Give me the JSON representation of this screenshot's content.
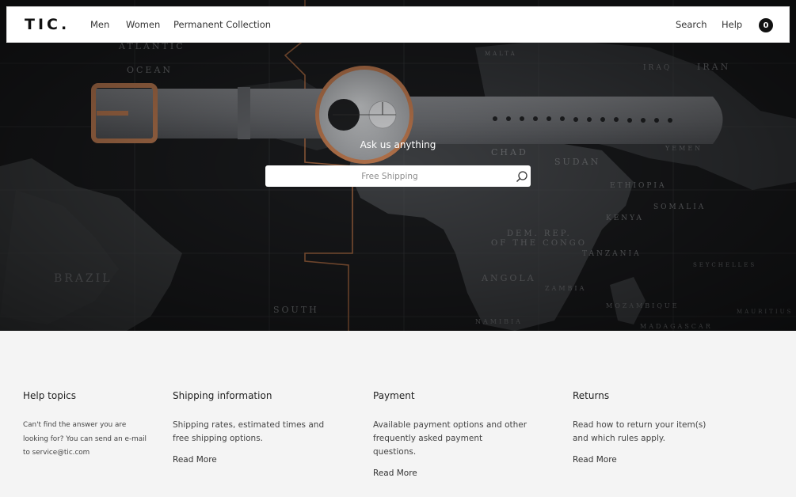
{
  "brand": {
    "logo": "TIC."
  },
  "nav": {
    "links": [
      "Men",
      "Women",
      "Permanent Collection"
    ],
    "search_label": "Search",
    "help_label": "Help",
    "cart_count": "0"
  },
  "hero": {
    "prompt": "Ask us anything",
    "search_placeholder": "Free Shipping"
  },
  "footer": {
    "help_topics": {
      "title": "Help topics",
      "text": "Can't find the answer you are looking for? You can send an e-mail to service@tic.com"
    },
    "shipping": {
      "title": "Shipping information",
      "text": "Shipping rates, estimated times and free shipping options.",
      "link": "Read More"
    },
    "payment": {
      "title": "Payment",
      "text": "Available payment options and other frequently asked payment questions.",
      "link": "Read More"
    },
    "returns": {
      "title": "Returns",
      "text": "Read how to return your item(s) and which rules apply.",
      "link": "Read More"
    }
  },
  "map_labels": [
    "ATLANTIC",
    "OCEAN",
    "BRAZIL",
    "SOUTH",
    "CHAD",
    "SUDAN",
    "ETHIOPIA",
    "SOMALIA",
    "KENYA",
    "TANZANIA",
    "ANGOLA",
    "ZAMBIA",
    "NAMIBIA",
    "MOZAMBIQUE",
    "IRAN",
    "IRAQ",
    "YEMEN",
    "DEM. REP. OF THE CONGO",
    "SEYCHELLES",
    "MALTA",
    "MADAGASCAR",
    "MAURITIUS"
  ],
  "icons": {
    "search": "search-icon"
  }
}
